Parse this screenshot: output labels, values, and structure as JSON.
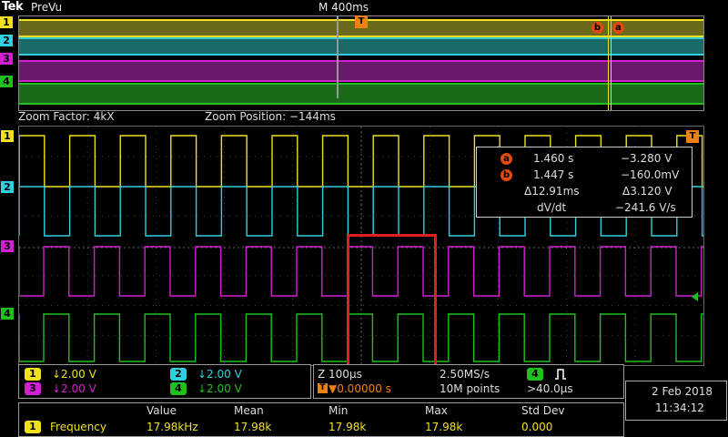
{
  "brand": "Tek",
  "mode": "PreVu",
  "timebase": "M 400ms",
  "zoom": {
    "factor_label": "Zoom Factor: 4kX",
    "position_label": "Zoom Position: −144ms"
  },
  "channels": [
    {
      "id": "1",
      "color": "#f0e020"
    },
    {
      "id": "2",
      "color": "#30d0e0"
    },
    {
      "id": "3",
      "color": "#d020d0"
    },
    {
      "id": "4",
      "color": "#20c020"
    }
  ],
  "cursor_markers": {
    "a": "a",
    "b": "b",
    "trigger": "T"
  },
  "cursor_readout": {
    "a": {
      "time": "1.460 s",
      "volt": "−3.280 V"
    },
    "b": {
      "time": "1.447 s",
      "volt": "−160.0mV"
    },
    "delta": {
      "time": "Δ12.91ms",
      "volt": "Δ3.120 V"
    },
    "dvdt_label": "dV/dt",
    "dvdt_value": "−241.6 V/s"
  },
  "vertical": [
    {
      "ch": "1",
      "value": "↓2.00 V"
    },
    {
      "ch": "2",
      "value": "↓2.00 V"
    },
    {
      "ch": "3",
      "value": "↓2.00 V"
    },
    {
      "ch": "4",
      "value": "↓2.00 V"
    }
  ],
  "horizontal": {
    "zoom_scale": "Z 100μs",
    "sample_rate": "2.50MS/s",
    "trigger_pos": "▼0.00000 s",
    "record_length": "10M points",
    "trigger_ch": "4",
    "trigger_level": ">40.0μs"
  },
  "measurements": {
    "headers": [
      "Value",
      "Mean",
      "Min",
      "Max",
      "Std Dev"
    ],
    "rows": [
      {
        "ch": "1",
        "name": "Frequency",
        "values": [
          "17.98kHz",
          "17.98k",
          "17.98k",
          "17.98k",
          "0.000"
        ]
      }
    ]
  },
  "datetime": {
    "date": "2 Feb  2018",
    "time": "11:34:12"
  }
}
